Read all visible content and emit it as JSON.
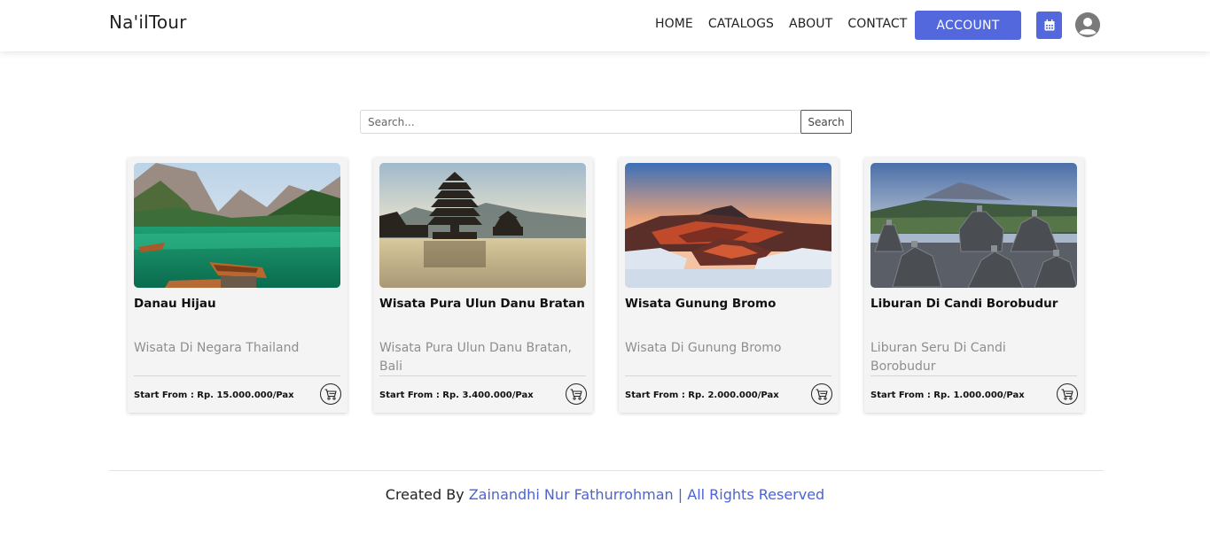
{
  "navbar": {
    "brand": "Na'ilTour",
    "links": [
      "HOME",
      "CATALOGS",
      "ABOUT",
      "CONTACT"
    ],
    "account_label": "ACCOUNT",
    "calendar_icon": "calendar-icon",
    "avatar_icon": "user-avatar-icon",
    "accent_color": "#5468de"
  },
  "search": {
    "placeholder": "Search...",
    "button_label": "Search"
  },
  "cards": [
    {
      "title": "Danau Hijau",
      "description": "Wisata Di Negara Thailand",
      "price": "Start From : Rp. 15.000.000/Pax",
      "cart_icon": "cart-icon"
    },
    {
      "title": "Wisata Pura Ulun Danu Bratan",
      "description": "Wisata Pura Ulun Danu Bratan, Bali",
      "price": "Start From : Rp. 3.400.000/Pax",
      "cart_icon": "cart-icon"
    },
    {
      "title": "Wisata Gunung Bromo",
      "description": "Wisata Di Gunung Bromo",
      "price": "Start From : Rp. 2.000.000/Pax",
      "cart_icon": "cart-icon"
    },
    {
      "title": "Liburan Di Candi Borobudur",
      "description": "Liburan Seru Di Candi Borobudur",
      "price": "Start From : Rp. 1.000.000/Pax",
      "cart_icon": "cart-icon"
    }
  ],
  "footer": {
    "prefix": "Created By ",
    "link_text": "Zainandhi Nur Fathurrohman | All Rights Reserved",
    "link_color": "#4c63d8"
  }
}
